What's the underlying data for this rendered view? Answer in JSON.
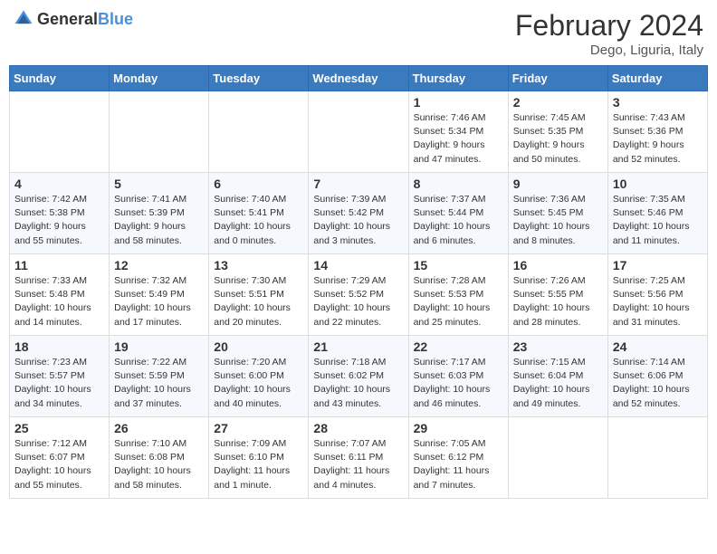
{
  "header": {
    "logo_general": "General",
    "logo_blue": "Blue",
    "title": "February 2024",
    "subtitle": "Dego, Liguria, Italy"
  },
  "days_of_week": [
    "Sunday",
    "Monday",
    "Tuesday",
    "Wednesday",
    "Thursday",
    "Friday",
    "Saturday"
  ],
  "weeks": [
    [
      {
        "day": "",
        "info": ""
      },
      {
        "day": "",
        "info": ""
      },
      {
        "day": "",
        "info": ""
      },
      {
        "day": "",
        "info": ""
      },
      {
        "day": "1",
        "info": "Sunrise: 7:46 AM\nSunset: 5:34 PM\nDaylight: 9 hours\nand 47 minutes."
      },
      {
        "day": "2",
        "info": "Sunrise: 7:45 AM\nSunset: 5:35 PM\nDaylight: 9 hours\nand 50 minutes."
      },
      {
        "day": "3",
        "info": "Sunrise: 7:43 AM\nSunset: 5:36 PM\nDaylight: 9 hours\nand 52 minutes."
      }
    ],
    [
      {
        "day": "4",
        "info": "Sunrise: 7:42 AM\nSunset: 5:38 PM\nDaylight: 9 hours\nand 55 minutes."
      },
      {
        "day": "5",
        "info": "Sunrise: 7:41 AM\nSunset: 5:39 PM\nDaylight: 9 hours\nand 58 minutes."
      },
      {
        "day": "6",
        "info": "Sunrise: 7:40 AM\nSunset: 5:41 PM\nDaylight: 10 hours\nand 0 minutes."
      },
      {
        "day": "7",
        "info": "Sunrise: 7:39 AM\nSunset: 5:42 PM\nDaylight: 10 hours\nand 3 minutes."
      },
      {
        "day": "8",
        "info": "Sunrise: 7:37 AM\nSunset: 5:44 PM\nDaylight: 10 hours\nand 6 minutes."
      },
      {
        "day": "9",
        "info": "Sunrise: 7:36 AM\nSunset: 5:45 PM\nDaylight: 10 hours\nand 8 minutes."
      },
      {
        "day": "10",
        "info": "Sunrise: 7:35 AM\nSunset: 5:46 PM\nDaylight: 10 hours\nand 11 minutes."
      }
    ],
    [
      {
        "day": "11",
        "info": "Sunrise: 7:33 AM\nSunset: 5:48 PM\nDaylight: 10 hours\nand 14 minutes."
      },
      {
        "day": "12",
        "info": "Sunrise: 7:32 AM\nSunset: 5:49 PM\nDaylight: 10 hours\nand 17 minutes."
      },
      {
        "day": "13",
        "info": "Sunrise: 7:30 AM\nSunset: 5:51 PM\nDaylight: 10 hours\nand 20 minutes."
      },
      {
        "day": "14",
        "info": "Sunrise: 7:29 AM\nSunset: 5:52 PM\nDaylight: 10 hours\nand 22 minutes."
      },
      {
        "day": "15",
        "info": "Sunrise: 7:28 AM\nSunset: 5:53 PM\nDaylight: 10 hours\nand 25 minutes."
      },
      {
        "day": "16",
        "info": "Sunrise: 7:26 AM\nSunset: 5:55 PM\nDaylight: 10 hours\nand 28 minutes."
      },
      {
        "day": "17",
        "info": "Sunrise: 7:25 AM\nSunset: 5:56 PM\nDaylight: 10 hours\nand 31 minutes."
      }
    ],
    [
      {
        "day": "18",
        "info": "Sunrise: 7:23 AM\nSunset: 5:57 PM\nDaylight: 10 hours\nand 34 minutes."
      },
      {
        "day": "19",
        "info": "Sunrise: 7:22 AM\nSunset: 5:59 PM\nDaylight: 10 hours\nand 37 minutes."
      },
      {
        "day": "20",
        "info": "Sunrise: 7:20 AM\nSunset: 6:00 PM\nDaylight: 10 hours\nand 40 minutes."
      },
      {
        "day": "21",
        "info": "Sunrise: 7:18 AM\nSunset: 6:02 PM\nDaylight: 10 hours\nand 43 minutes."
      },
      {
        "day": "22",
        "info": "Sunrise: 7:17 AM\nSunset: 6:03 PM\nDaylight: 10 hours\nand 46 minutes."
      },
      {
        "day": "23",
        "info": "Sunrise: 7:15 AM\nSunset: 6:04 PM\nDaylight: 10 hours\nand 49 minutes."
      },
      {
        "day": "24",
        "info": "Sunrise: 7:14 AM\nSunset: 6:06 PM\nDaylight: 10 hours\nand 52 minutes."
      }
    ],
    [
      {
        "day": "25",
        "info": "Sunrise: 7:12 AM\nSunset: 6:07 PM\nDaylight: 10 hours\nand 55 minutes."
      },
      {
        "day": "26",
        "info": "Sunrise: 7:10 AM\nSunset: 6:08 PM\nDaylight: 10 hours\nand 58 minutes."
      },
      {
        "day": "27",
        "info": "Sunrise: 7:09 AM\nSunset: 6:10 PM\nDaylight: 11 hours\nand 1 minute."
      },
      {
        "day": "28",
        "info": "Sunrise: 7:07 AM\nSunset: 6:11 PM\nDaylight: 11 hours\nand 4 minutes."
      },
      {
        "day": "29",
        "info": "Sunrise: 7:05 AM\nSunset: 6:12 PM\nDaylight: 11 hours\nand 7 minutes."
      },
      {
        "day": "",
        "info": ""
      },
      {
        "day": "",
        "info": ""
      }
    ]
  ]
}
